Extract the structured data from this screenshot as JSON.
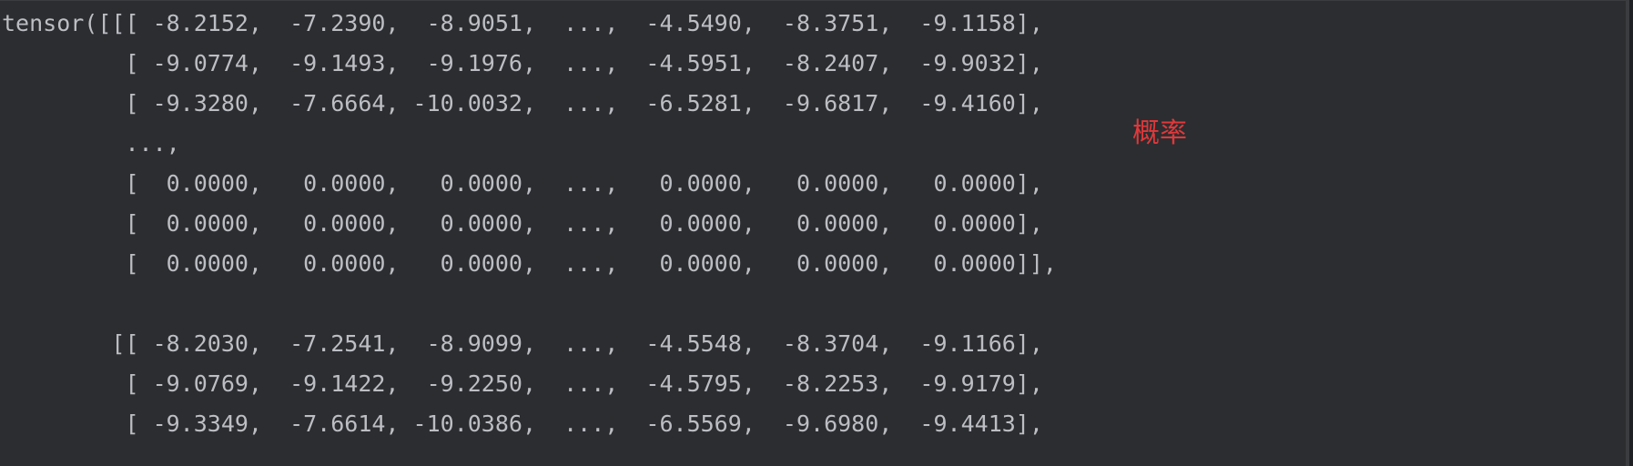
{
  "console": {
    "lines": [
      "tensor([[[ -8.2152,  -7.2390,  -8.9051,  ...,  -4.5490,  -8.3751,  -9.1158],",
      "         [ -9.0774,  -9.1493,  -9.1976,  ...,  -4.5951,  -8.2407,  -9.9032],",
      "         [ -9.3280,  -7.6664, -10.0032,  ...,  -6.5281,  -9.6817,  -9.4160],",
      "         ...,",
      "         [  0.0000,   0.0000,   0.0000,  ...,   0.0000,   0.0000,   0.0000],",
      "         [  0.0000,   0.0000,   0.0000,  ...,   0.0000,   0.0000,   0.0000],",
      "         [  0.0000,   0.0000,   0.0000,  ...,   0.0000,   0.0000,   0.0000]],",
      "",
      "        [[ -8.2030,  -7.2541,  -8.9099,  ...,  -4.5548,  -8.3704,  -9.1166],",
      "         [ -9.0769,  -9.1422,  -9.2250,  ...,  -4.5795,  -8.2253,  -9.9179],",
      "         [ -9.3349,  -7.6614, -10.0386,  ...,  -6.5569,  -9.6980,  -9.4413],",
      "         ...,"
    ]
  },
  "annotation": {
    "text": "概率"
  },
  "colors": {
    "background": "#2b2d30",
    "text": "#bcbec4",
    "annotation": "#e0383a"
  }
}
